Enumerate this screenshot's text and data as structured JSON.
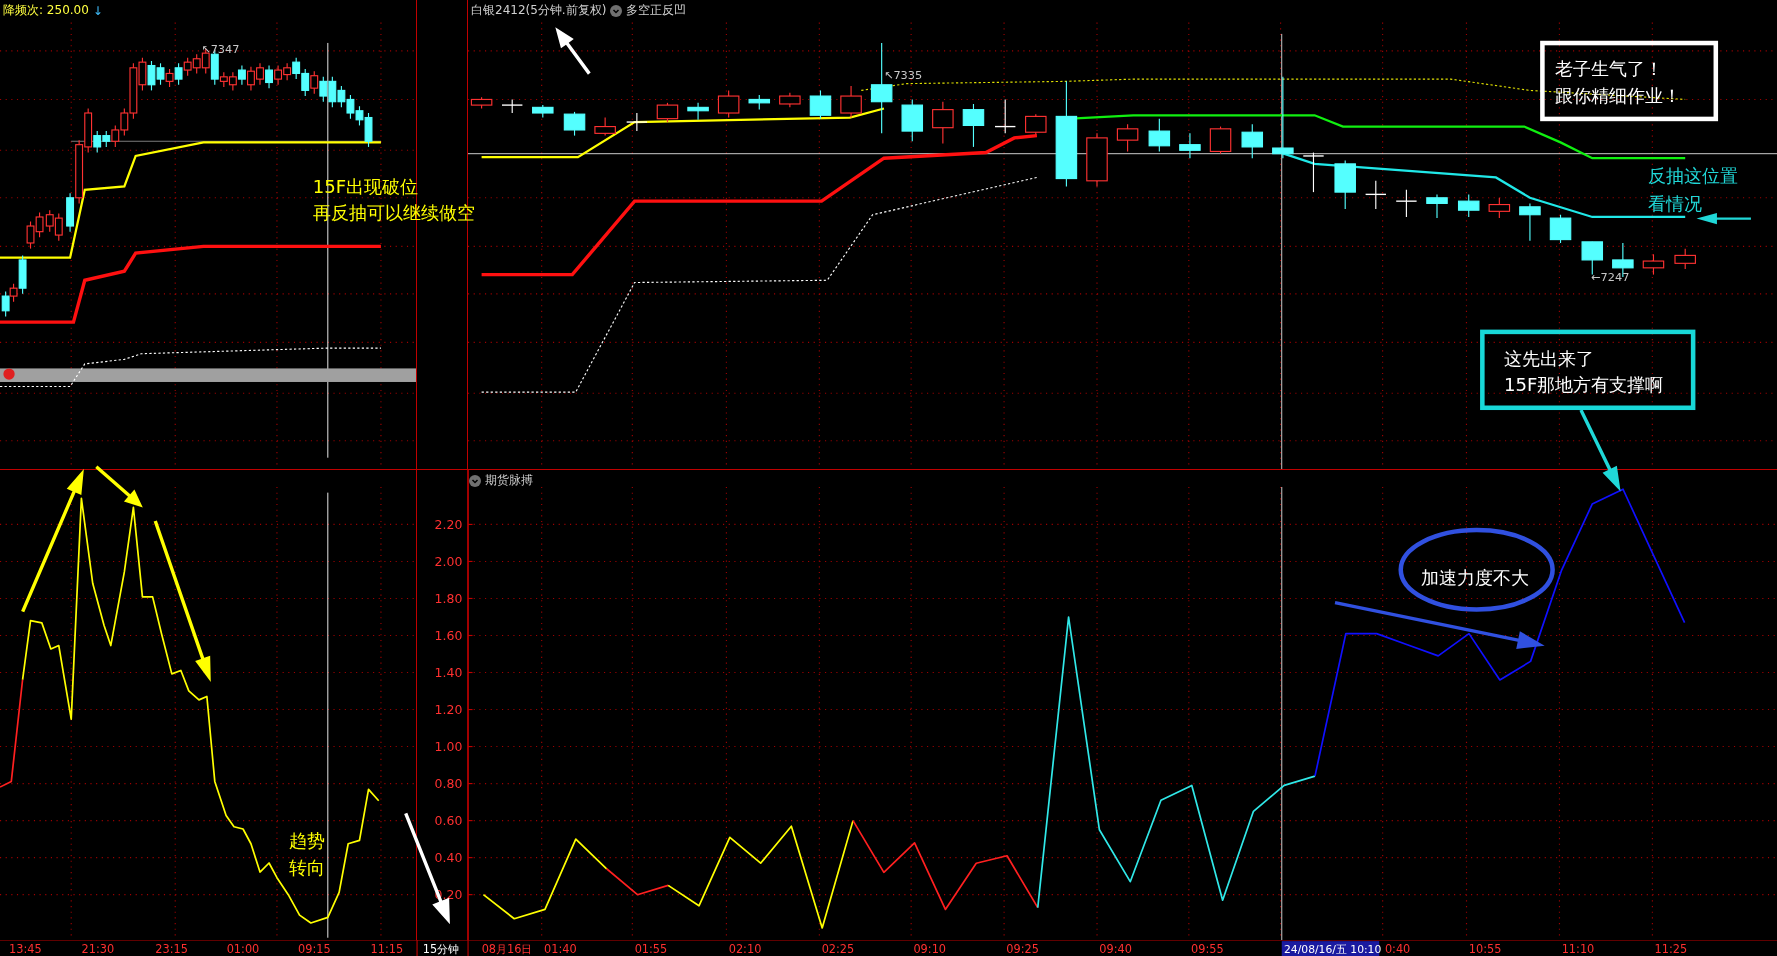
{
  "left_panel": {
    "header": {
      "label": "降频次: 250.00",
      "arrow": "↓"
    },
    "price_label": "↖7347",
    "breakdown_note": [
      "15F出现破位",
      "再反抽可以继续做空"
    ],
    "trend_note": [
      "趋势",
      "转向"
    ],
    "time_axis": [
      "13:45",
      "21:30",
      "23:15",
      "01:00",
      "09:15",
      "11:15"
    ]
  },
  "period_label": "15分钟",
  "main_panel": {
    "title": "白银2412(5分钟.前复权)",
    "indicator": "多空正反凹",
    "price_labels": [
      "↖7335",
      "←7247"
    ],
    "angry_note": [
      "老子生气了！",
      "跟你精细作业！"
    ],
    "watch_note": [
      "反抽这位置",
      "看情况"
    ]
  },
  "indicator_panel": {
    "title": "期货脉搏",
    "speed_note": "加速力度不大",
    "support_note": [
      "这先出来了",
      "15F那地方有支撑啊"
    ],
    "chart_data": {
      "type": "line",
      "grid": true,
      "ylim": [
        -0.045,
        2.494
      ],
      "categories": [
        null,
        null,
        null,
        null,
        null,
        null,
        null,
        null,
        null,
        null,
        null,
        null,
        null,
        null,
        null,
        null,
        null,
        null,
        null,
        null,
        null,
        null,
        null,
        null,
        null,
        null,
        null,
        null,
        null,
        null,
        null,
        null,
        null,
        null,
        null,
        null,
        null,
        null,
        null,
        null
      ],
      "yticks": [
        {
          "value": 0.2,
          "label": "0.20"
        },
        {
          "value": 0.4,
          "label": "0.40"
        },
        {
          "value": 0.6,
          "label": "0.60"
        },
        {
          "value": 0.8,
          "label": "0.80"
        },
        {
          "value": 1.0,
          "label": "1.00"
        },
        {
          "value": 1.2,
          "label": "1.20"
        },
        {
          "value": 1.4,
          "label": "1.40"
        },
        {
          "value": 1.6,
          "label": "1.60"
        },
        {
          "value": 1.8,
          "label": "1.80"
        },
        {
          "value": 2.0,
          "label": "2.00"
        },
        {
          "value": 2.2,
          "label": "2.20"
        }
      ],
      "series": [
        {
          "color": "#ffff00",
          "values": [
            0.2,
            0.07,
            0.12,
            0.5,
            0.34,
            null,
            null,
            null,
            null,
            null,
            null,
            null,
            null,
            null,
            null,
            null,
            null,
            null,
            null,
            null,
            null,
            null,
            null,
            null,
            null,
            null,
            null,
            null,
            null,
            null,
            null,
            null,
            null,
            null,
            null,
            null,
            null,
            null,
            null,
            null
          ]
        },
        {
          "color": "#ff2020",
          "values": [
            null,
            null,
            null,
            null,
            0.34,
            0.2,
            0.25,
            null,
            null,
            null,
            null,
            null,
            null,
            null,
            null,
            null,
            null,
            null,
            null,
            null,
            null,
            null,
            null,
            null,
            null,
            null,
            null,
            null,
            null,
            null,
            null,
            null,
            null,
            null,
            null,
            null,
            null,
            null,
            null,
            null
          ]
        },
        {
          "color": "#ffff00",
          "values": [
            null,
            null,
            null,
            null,
            null,
            null,
            0.25,
            0.14,
            0.51,
            0.37,
            0.57,
            0.02,
            0.6,
            null,
            null,
            null,
            null,
            null,
            null,
            null,
            null,
            null,
            null,
            null,
            null,
            null,
            null,
            null,
            null,
            null,
            null,
            null,
            null,
            null,
            null,
            null,
            null,
            null,
            null,
            null
          ]
        },
        {
          "color": "#ff2020",
          "values": [
            null,
            null,
            null,
            null,
            null,
            null,
            null,
            null,
            null,
            null,
            null,
            null,
            0.6,
            0.32,
            0.48,
            0.12,
            0.37,
            0.41,
            0.13,
            null,
            null,
            null,
            null,
            null,
            null,
            null,
            null,
            null,
            null,
            null,
            null,
            null,
            null,
            null,
            null,
            null,
            null,
            null,
            null,
            null
          ]
        },
        {
          "color": "#30e8e8",
          "values": [
            null,
            null,
            null,
            null,
            null,
            null,
            null,
            null,
            null,
            null,
            null,
            null,
            null,
            null,
            null,
            null,
            null,
            null,
            0.13,
            1.7,
            0.55,
            0.27,
            0.71,
            0.79,
            0.17,
            0.65,
            0.79,
            0.84,
            null,
            null,
            null,
            null,
            null,
            null,
            null,
            null,
            null,
            null,
            null,
            null
          ]
        },
        {
          "color": "#1010ff",
          "values": [
            null,
            null,
            null,
            null,
            null,
            null,
            null,
            null,
            null,
            null,
            null,
            null,
            null,
            null,
            null,
            null,
            null,
            null,
            null,
            null,
            null,
            null,
            null,
            null,
            null,
            null,
            null,
            0.84,
            1.61,
            1.61,
            1.55,
            1.49,
            1.61,
            1.36,
            1.46,
            1.95,
            2.31,
            2.39,
            2.03,
            1.67
          ]
        }
      ]
    }
  },
  "time_axis": [
    {
      "label": "08月16日",
      "highlighted": false
    },
    {
      "label": "01:40",
      "highlighted": false
    },
    {
      "label": "01:55",
      "highlighted": false
    },
    {
      "label": "02:10",
      "highlighted": false
    },
    {
      "label": "02:25",
      "highlighted": false
    },
    {
      "label": "09:10",
      "highlighted": false
    },
    {
      "label": "09:25",
      "highlighted": false
    },
    {
      "label": "09:40",
      "highlighted": false
    },
    {
      "label": "09:55",
      "highlighted": false
    },
    {
      "label": "24/08/16/五 10:10",
      "highlighted": true
    },
    {
      "label": "0:40",
      "highlighted": false
    },
    {
      "label": "10:55",
      "highlighted": false
    },
    {
      "label": "11:10",
      "highlighted": false
    },
    {
      "label": "11:25",
      "highlighted": false
    }
  ]
}
